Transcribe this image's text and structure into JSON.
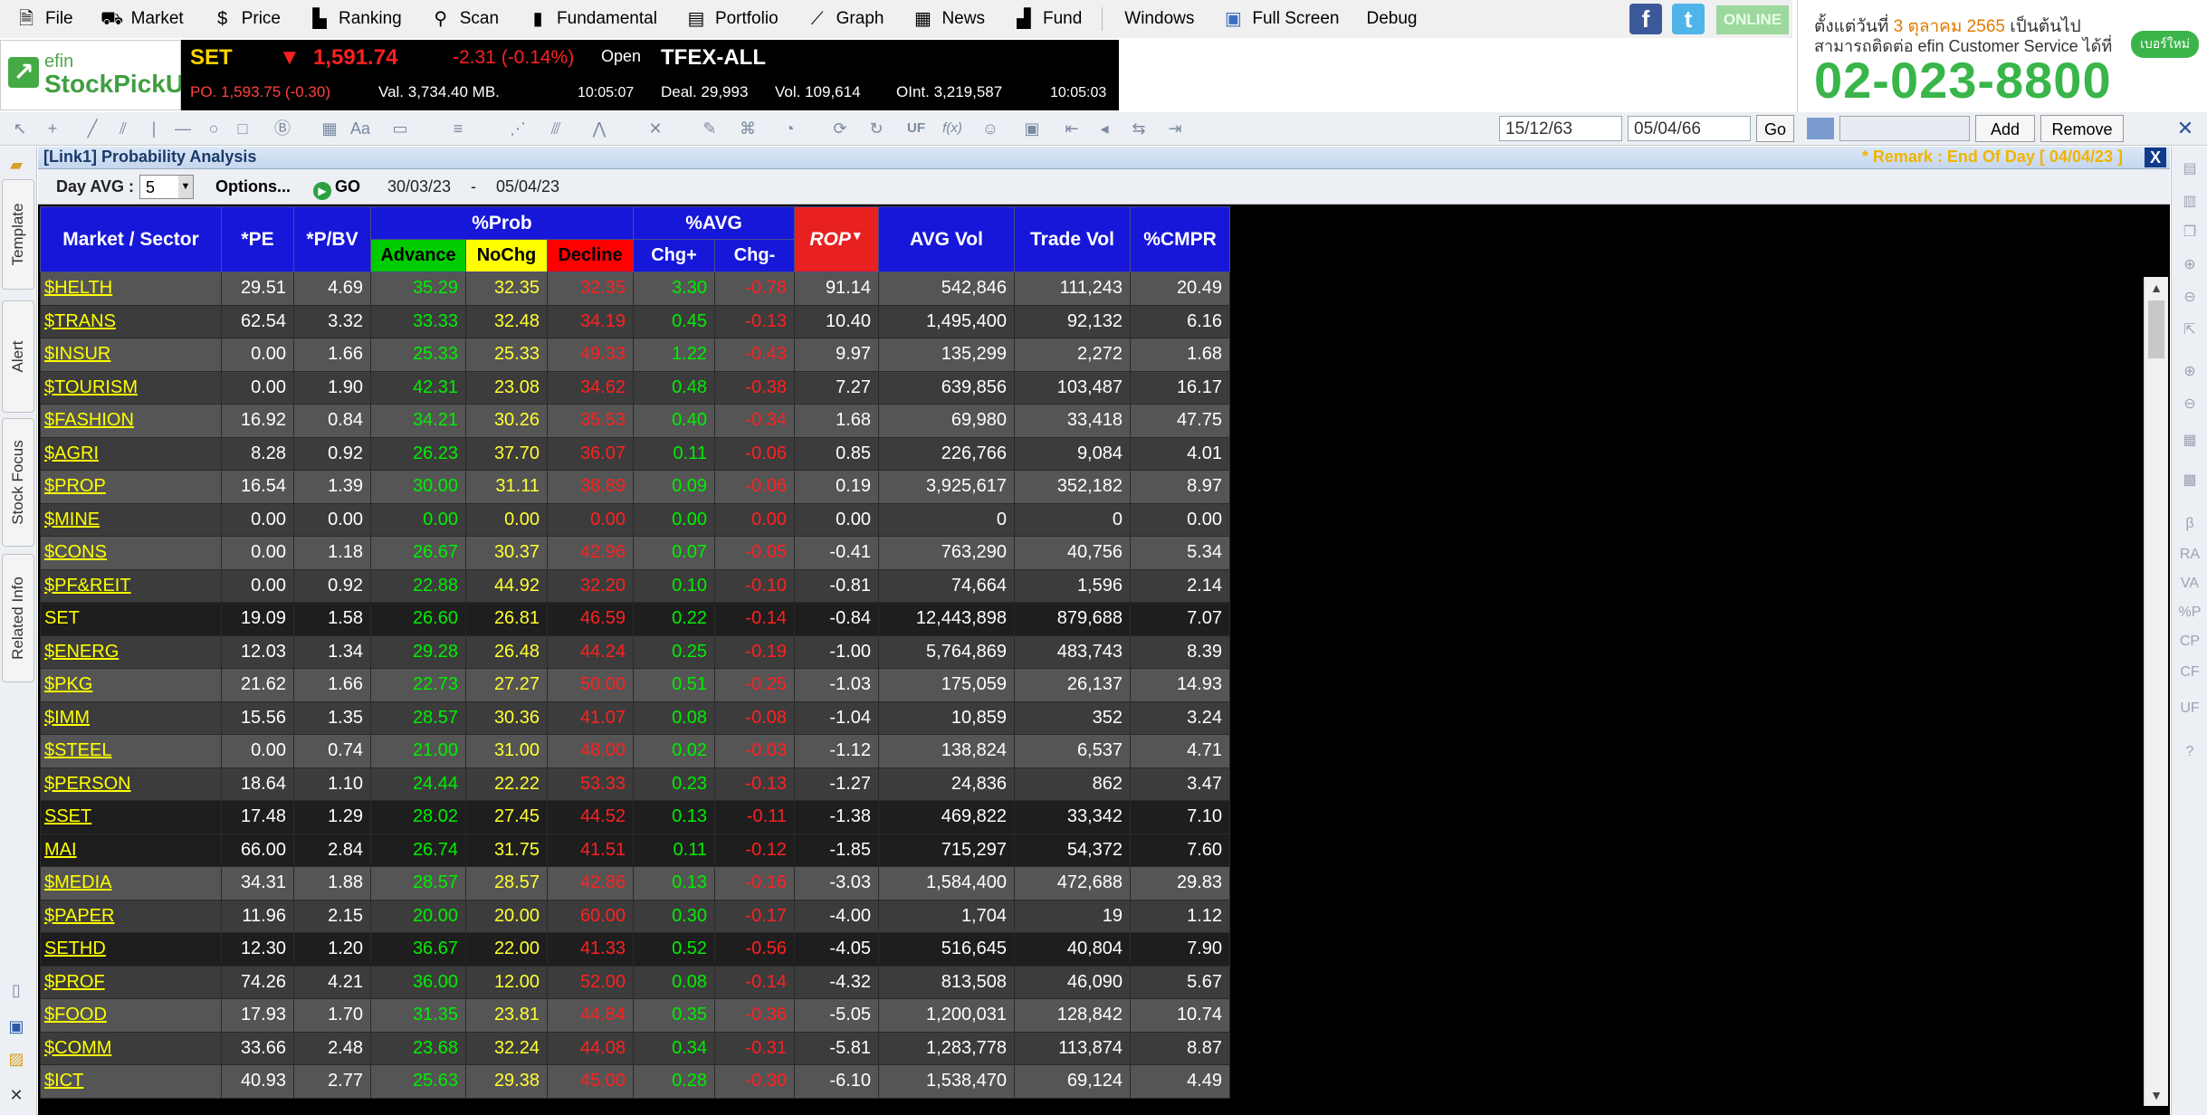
{
  "menu": [
    {
      "label": "File",
      "icon": "file-icon"
    },
    {
      "label": "Market",
      "icon": "market-icon"
    },
    {
      "label": "Price",
      "icon": "dollar-icon"
    },
    {
      "label": "Ranking",
      "icon": "ranking-icon"
    },
    {
      "label": "Scan",
      "icon": "scan-icon"
    },
    {
      "label": "Fundamental",
      "icon": "fundamental-icon"
    },
    {
      "label": "Portfolio",
      "icon": "portfolio-icon"
    },
    {
      "label": "Graph",
      "icon": "graph-icon"
    },
    {
      "label": "News",
      "icon": "news-icon"
    },
    {
      "label": "Fund",
      "icon": "fund-icon"
    }
  ],
  "menu_right": [
    "Windows",
    "Full Screen",
    "Debug"
  ],
  "online": "ONLINE",
  "ad": {
    "line1a": "ตั้งแต่วันที่ ",
    "line1b": "3 ตุลาคม 2565",
    "line1c": " เป็นต้นไป",
    "line2": "สามารถติดต่อ efin Customer Service ได้ที่",
    "badge": "เบอร์ใหม่",
    "phone": "02-023-8800"
  },
  "logo": {
    "top": "efin",
    "bottom": "StockPickUp"
  },
  "ticker": {
    "set": {
      "name": "SET",
      "arrow": "▼",
      "index": "1,591.74",
      "change": "-2.31 (-0.14%)",
      "status": "Open",
      "po": "PO. 1,593.75 (-0.30)",
      "val": "Val. 3,734.40 MB.",
      "time": "10:05:07"
    },
    "tfex": {
      "name": "TFEX-ALL",
      "deal": "Deal. 29,993",
      "vol": "Vol. 109,614",
      "oint": "OInt. 3,219,587",
      "time": "10:05:03"
    }
  },
  "toolbar": {
    "date_from": "15/12/63",
    "date_to": "05/04/66",
    "go": "Go",
    "add": "Add",
    "remove": "Remove"
  },
  "side_tabs": [
    "Template",
    "Alert",
    "Stock Focus",
    "Related Info"
  ],
  "right_tools": [
    "β",
    "RA",
    "VA",
    "%P",
    "CP",
    "CF",
    "UF"
  ],
  "panel": {
    "title": "[Link1] Probability Analysis",
    "remark": "* Remark : End Of Day [ 04/04/23 ]",
    "close": "X"
  },
  "options": {
    "day_avg_label": "Day AVG :",
    "day_avg_value": "5",
    "options_label": "Options...",
    "go_label": "GO",
    "date_from": "30/03/23",
    "dash": "-",
    "date_to": "05/04/23"
  },
  "columns": {
    "market": "Market / Sector",
    "pe": "*PE",
    "pbv": "*P/BV",
    "prob": "%Prob",
    "advance": "Advance",
    "nochg": "NoChg",
    "decline": "Decline",
    "avg": "%AVG",
    "chgp": "Chg+",
    "chgm": "Chg-",
    "rop": "ROP",
    "avgvol": "AVG Vol",
    "tradevol": "Trade Vol",
    "cmpr": "%CMPR"
  },
  "rows": [
    {
      "sym": "$HELTH",
      "pe": "29.51",
      "pbv": "4.69",
      "adv": "35.29",
      "noc": "32.35",
      "dec": "32.35",
      "chgp": "3.30",
      "chgm": "-0.78",
      "rop": "91.14",
      "avgvol": "542,846",
      "tradevol": "111,243",
      "cmpr": "20.49"
    },
    {
      "sym": "$TRANS",
      "pe": "62.54",
      "pbv": "3.32",
      "adv": "33.33",
      "noc": "32.48",
      "dec": "34.19",
      "chgp": "0.45",
      "chgm": "-0.13",
      "rop": "10.40",
      "avgvol": "1,495,400",
      "tradevol": "92,132",
      "cmpr": "6.16"
    },
    {
      "sym": "$INSUR",
      "pe": "0.00",
      "pbv": "1.66",
      "adv": "25.33",
      "noc": "25.33",
      "dec": "49.33",
      "chgp": "1.22",
      "chgm": "-0.43",
      "rop": "9.97",
      "avgvol": "135,299",
      "tradevol": "2,272",
      "cmpr": "1.68"
    },
    {
      "sym": "$TOURISM",
      "pe": "0.00",
      "pbv": "1.90",
      "adv": "42.31",
      "noc": "23.08",
      "dec": "34.62",
      "chgp": "0.48",
      "chgm": "-0.38",
      "rop": "7.27",
      "avgvol": "639,856",
      "tradevol": "103,487",
      "cmpr": "16.17"
    },
    {
      "sym": "$FASHION",
      "pe": "16.92",
      "pbv": "0.84",
      "adv": "34.21",
      "noc": "30.26",
      "dec": "35.53",
      "chgp": "0.40",
      "chgm": "-0.34",
      "rop": "1.68",
      "avgvol": "69,980",
      "tradevol": "33,418",
      "cmpr": "47.75"
    },
    {
      "sym": "$AGRI",
      "pe": "8.28",
      "pbv": "0.92",
      "adv": "26.23",
      "noc": "37.70",
      "dec": "36.07",
      "chgp": "0.11",
      "chgm": "-0.06",
      "rop": "0.85",
      "avgvol": "226,766",
      "tradevol": "9,084",
      "cmpr": "4.01"
    },
    {
      "sym": "$PROP",
      "pe": "16.54",
      "pbv": "1.39",
      "adv": "30.00",
      "noc": "31.11",
      "dec": "38.89",
      "chgp": "0.09",
      "chgm": "-0.06",
      "rop": "0.19",
      "avgvol": "3,925,617",
      "tradevol": "352,182",
      "cmpr": "8.97"
    },
    {
      "sym": "$MINE",
      "pe": "0.00",
      "pbv": "0.00",
      "adv": "0.00",
      "noc": "0.00",
      "dec": "0.00",
      "chgp": "0.00",
      "chgm": "0.00",
      "rop": "0.00",
      "avgvol": "0",
      "tradevol": "0",
      "cmpr": "0.00"
    },
    {
      "sym": "$CONS",
      "pe": "0.00",
      "pbv": "1.18",
      "adv": "26.67",
      "noc": "30.37",
      "dec": "42.96",
      "chgp": "0.07",
      "chgm": "-0.05",
      "rop": "-0.41",
      "avgvol": "763,290",
      "tradevol": "40,756",
      "cmpr": "5.34"
    },
    {
      "sym": "$PF&REIT",
      "pe": "0.00",
      "pbv": "0.92",
      "adv": "22.88",
      "noc": "44.92",
      "dec": "32.20",
      "chgp": "0.10",
      "chgm": "-0.10",
      "rop": "-0.81",
      "avgvol": "74,664",
      "tradevol": "1,596",
      "cmpr": "2.14"
    },
    {
      "sym": "SET",
      "pe": "19.09",
      "pbv": "1.58",
      "adv": "26.60",
      "noc": "26.81",
      "dec": "46.59",
      "chgp": "0.22",
      "chgm": "-0.14",
      "rop": "-0.84",
      "avgvol": "12,443,898",
      "tradevol": "879,688",
      "cmpr": "7.07",
      "market": true
    },
    {
      "sym": "$ENERG",
      "pe": "12.03",
      "pbv": "1.34",
      "adv": "29.28",
      "noc": "26.48",
      "dec": "44.24",
      "chgp": "0.25",
      "chgm": "-0.19",
      "rop": "-1.00",
      "avgvol": "5,764,869",
      "tradevol": "483,743",
      "cmpr": "8.39"
    },
    {
      "sym": "$PKG",
      "pe": "21.62",
      "pbv": "1.66",
      "adv": "22.73",
      "noc": "27.27",
      "dec": "50.00",
      "chgp": "0.51",
      "chgm": "-0.25",
      "rop": "-1.03",
      "avgvol": "175,059",
      "tradevol": "26,137",
      "cmpr": "14.93"
    },
    {
      "sym": "$IMM",
      "pe": "15.56",
      "pbv": "1.35",
      "adv": "28.57",
      "noc": "30.36",
      "dec": "41.07",
      "chgp": "0.08",
      "chgm": "-0.08",
      "rop": "-1.04",
      "avgvol": "10,859",
      "tradevol": "352",
      "cmpr": "3.24"
    },
    {
      "sym": "$STEEL",
      "pe": "0.00",
      "pbv": "0.74",
      "adv": "21.00",
      "noc": "31.00",
      "dec": "48.00",
      "chgp": "0.02",
      "chgm": "-0.03",
      "rop": "-1.12",
      "avgvol": "138,824",
      "tradevol": "6,537",
      "cmpr": "4.71"
    },
    {
      "sym": "$PERSON",
      "pe": "18.64",
      "pbv": "1.10",
      "adv": "24.44",
      "noc": "22.22",
      "dec": "53.33",
      "chgp": "0.23",
      "chgm": "-0.13",
      "rop": "-1.27",
      "avgvol": "24,836",
      "tradevol": "862",
      "cmpr": "3.47"
    },
    {
      "sym": "SSET",
      "pe": "17.48",
      "pbv": "1.29",
      "adv": "28.02",
      "noc": "27.45",
      "dec": "44.52",
      "chgp": "0.13",
      "chgm": "-0.11",
      "rop": "-1.38",
      "avgvol": "469,822",
      "tradevol": "33,342",
      "cmpr": "7.10",
      "market": true
    },
    {
      "sym": "MAI",
      "pe": "66.00",
      "pbv": "2.84",
      "adv": "26.74",
      "noc": "31.75",
      "dec": "41.51",
      "chgp": "0.11",
      "chgm": "-0.12",
      "rop": "-1.85",
      "avgvol": "715,297",
      "tradevol": "54,372",
      "cmpr": "7.60",
      "market": true
    },
    {
      "sym": "$MEDIA",
      "pe": "34.31",
      "pbv": "1.88",
      "adv": "28.57",
      "noc": "28.57",
      "dec": "42.86",
      "chgp": "0.13",
      "chgm": "-0.16",
      "rop": "-3.03",
      "avgvol": "1,584,400",
      "tradevol": "472,688",
      "cmpr": "29.83"
    },
    {
      "sym": "$PAPER",
      "pe": "11.96",
      "pbv": "2.15",
      "adv": "20.00",
      "noc": "20.00",
      "dec": "60.00",
      "chgp": "0.30",
      "chgm": "-0.17",
      "rop": "-4.00",
      "avgvol": "1,704",
      "tradevol": "19",
      "cmpr": "1.12"
    },
    {
      "sym": "SETHD",
      "pe": "12.30",
      "pbv": "1.20",
      "adv": "36.67",
      "noc": "22.00",
      "dec": "41.33",
      "chgp": "0.52",
      "chgm": "-0.56",
      "rop": "-4.05",
      "avgvol": "516,645",
      "tradevol": "40,804",
      "cmpr": "7.90",
      "market": true
    },
    {
      "sym": "$PROF",
      "pe": "74.26",
      "pbv": "4.21",
      "adv": "36.00",
      "noc": "12.00",
      "dec": "52.00",
      "chgp": "0.08",
      "chgm": "-0.14",
      "rop": "-4.32",
      "avgvol": "813,508",
      "tradevol": "46,090",
      "cmpr": "5.67"
    },
    {
      "sym": "$FOOD",
      "pe": "17.93",
      "pbv": "1.70",
      "adv": "31.35",
      "noc": "23.81",
      "dec": "44.84",
      "chgp": "0.35",
      "chgm": "-0.36",
      "rop": "-5.05",
      "avgvol": "1,200,031",
      "tradevol": "128,842",
      "cmpr": "10.74"
    },
    {
      "sym": "$COMM",
      "pe": "33.66",
      "pbv": "2.48",
      "adv": "23.68",
      "noc": "32.24",
      "dec": "44.08",
      "chgp": "0.34",
      "chgm": "-0.31",
      "rop": "-5.81",
      "avgvol": "1,283,778",
      "tradevol": "113,874",
      "cmpr": "8.87"
    },
    {
      "sym": "$ICT",
      "pe": "40.93",
      "pbv": "2.77",
      "adv": "25.63",
      "noc": "29.38",
      "dec": "45.00",
      "chgp": "0.28",
      "chgm": "-0.30",
      "rop": "-6.10",
      "avgvol": "1,538,470",
      "tradevol": "69,124",
      "cmpr": "4.49"
    }
  ],
  "colors": {
    "header_blue": "#1717d9",
    "advance": "#00cc00",
    "nochg": "#ffff00",
    "decline": "#ff0000",
    "rop": "#e82020",
    "symbol": "#ffff00"
  }
}
